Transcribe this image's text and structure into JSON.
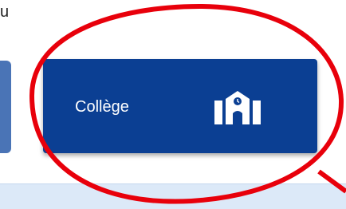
{
  "top_text": "u",
  "college_button": {
    "label": "Collège",
    "icon": "school-icon"
  },
  "colors": {
    "card_blue": "#0b3f93",
    "side_card_blue": "#4a74b6",
    "highlight_red": "#e8000b",
    "band_light_blue": "#dce9f8"
  }
}
